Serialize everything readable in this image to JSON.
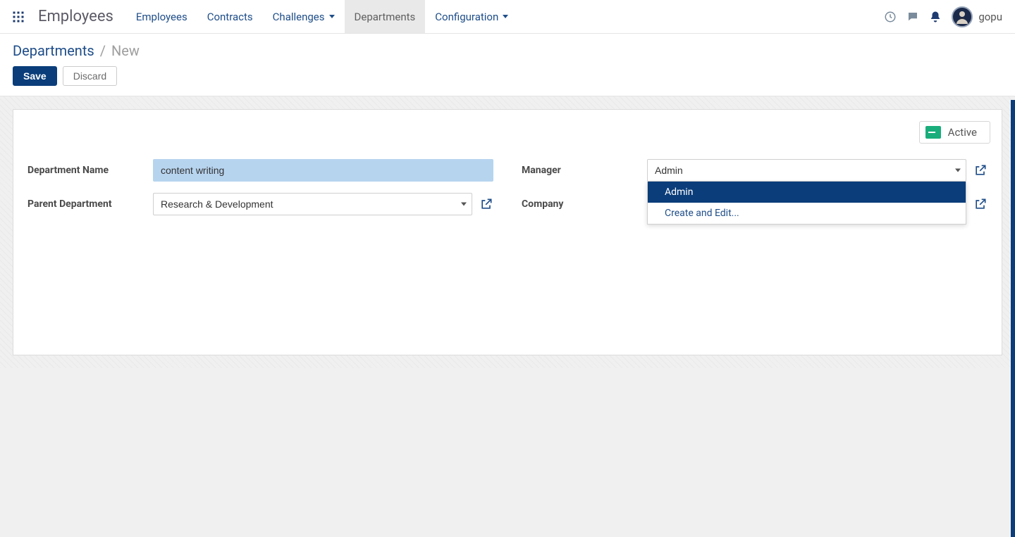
{
  "navbar": {
    "brand": "Employees",
    "items": [
      {
        "label": "Employees",
        "has_caret": false,
        "active": false
      },
      {
        "label": "Contracts",
        "has_caret": false,
        "active": false
      },
      {
        "label": "Challenges",
        "has_caret": true,
        "active": false
      },
      {
        "label": "Departments",
        "has_caret": false,
        "active": true
      },
      {
        "label": "Configuration",
        "has_caret": true,
        "active": false
      }
    ],
    "user": "gopu"
  },
  "breadcrumb": {
    "root": "Departments",
    "separator": "/",
    "current": "New"
  },
  "buttons": {
    "save": "Save",
    "discard": "Discard"
  },
  "status": {
    "label": "Active"
  },
  "form": {
    "left": [
      {
        "label": "Department Name",
        "type": "text",
        "value": "content writing"
      },
      {
        "label": "Parent Department",
        "type": "m2o",
        "value": "Research & Development",
        "external": true
      }
    ],
    "right": [
      {
        "label": "Manager",
        "type": "m2o",
        "value": "Admin",
        "external": true,
        "dropdown_open": true
      },
      {
        "label": "Company",
        "type": "m2o",
        "value": "",
        "external": true
      }
    ]
  },
  "manager_dropdown": {
    "options": [
      {
        "label": "Admin",
        "highlight": true
      },
      {
        "label": "Create and Edit...",
        "action": true
      }
    ]
  }
}
